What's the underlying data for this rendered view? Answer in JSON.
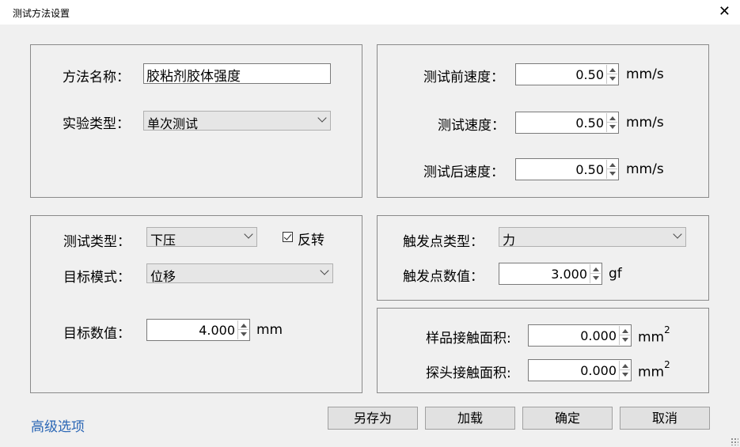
{
  "window": {
    "title": "测试方法设置",
    "close_glyph": "✕"
  },
  "method": {
    "name_label": "方法名称：",
    "name_value": "胶粘剂胶体强度",
    "experiment_type_label": "实验类型：",
    "experiment_type_value": "单次测试"
  },
  "speeds": {
    "pre_label": "测试前速度：",
    "pre_value": "0.50",
    "test_label": "测试速度：",
    "test_value": "0.50",
    "post_label": "测试后速度：",
    "post_value": "0.50",
    "unit": "mm/s"
  },
  "test": {
    "type_label": "测试类型：",
    "type_value": "下压",
    "reverse_label": "反转",
    "reverse_checked": true,
    "target_mode_label": "目标模式：",
    "target_mode_value": "位移",
    "target_value_label": "目标数值：",
    "target_value": "4.000",
    "target_unit": "mm"
  },
  "trigger": {
    "type_label": "触发点类型：",
    "type_value": "力",
    "value_label": "触发点数值：",
    "value": "3.000",
    "unit": "gf"
  },
  "area": {
    "sample_label": "样品接触面积:",
    "sample_value": "0.000",
    "probe_label": "探头接触面积:",
    "probe_value": "0.000",
    "unit_base": "mm",
    "unit_exp": "2"
  },
  "footer": {
    "advanced_link": "高级选项",
    "save_as": "另存为",
    "load": "加载",
    "ok": "确定",
    "cancel": "取消"
  }
}
